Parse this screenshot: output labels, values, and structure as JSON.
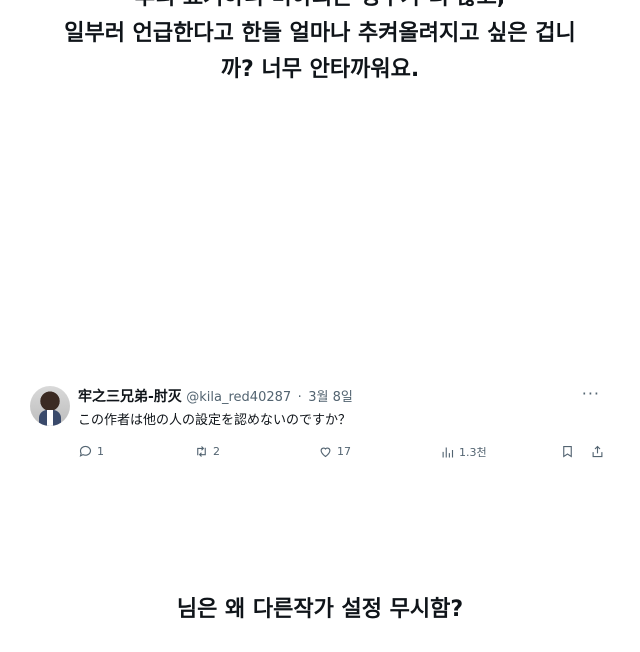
{
  "caption_top": {
    "lines": [
      "후리 표기하니 미아되는 경우가 더 많고,",
      "일부러 언급한다고 한들 얼마나 추켜올려지고 싶은 겁니",
      "까? 너무 안타까워요."
    ]
  },
  "tweet": {
    "display_name": "牢之三兄弟-肘灭",
    "handle": "@kila_red40287",
    "separator": "·",
    "date": "3월 8일",
    "text": "この作者は他の人の設定を認めないのですか？",
    "replies": "1",
    "retweets": "2",
    "likes": "17",
    "views": "1.3천",
    "icons": [
      "avatar",
      "more-icon",
      "reply-icon",
      "retweet-icon",
      "like-icon",
      "views-icon",
      "bookmark-icon",
      "share-icon"
    ]
  },
  "caption_bottom": {
    "text": "님은 왜 다른작가 설정 무시함?"
  }
}
